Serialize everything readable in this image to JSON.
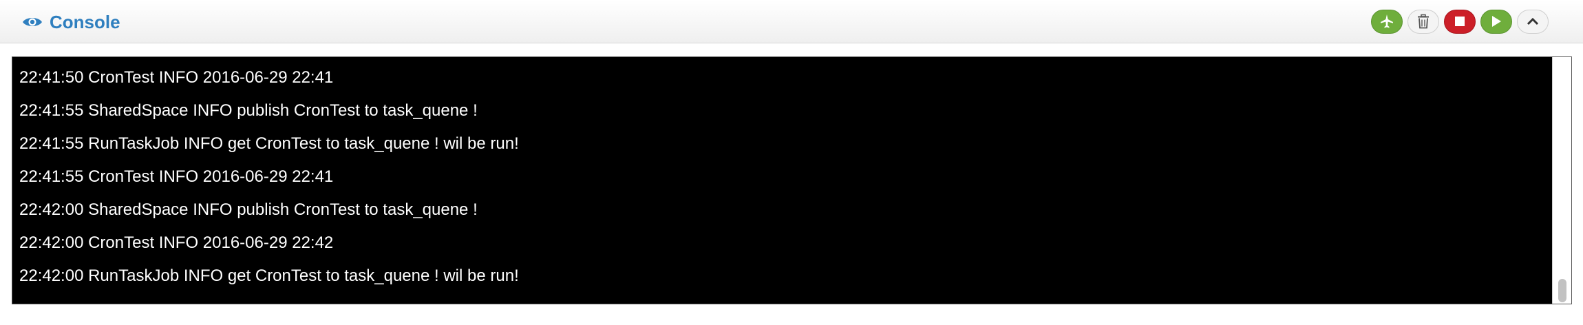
{
  "panel": {
    "title": "Console",
    "title_icon": "eye-icon",
    "accent_color": "#2f7fbf"
  },
  "toolbar": {
    "buttons": [
      {
        "name": "deploy-button",
        "icon": "plane-icon",
        "color": "#6fae3c"
      },
      {
        "name": "clear-button",
        "icon": "trash-icon",
        "color": "#f4f4f4"
      },
      {
        "name": "stop-button",
        "icon": "stop-icon",
        "color": "#cc1f28"
      },
      {
        "name": "run-button",
        "icon": "play-icon",
        "color": "#6fae3c"
      },
      {
        "name": "collapse-button",
        "icon": "chevron-up-icon",
        "color": "#f4f4f4"
      }
    ]
  },
  "console": {
    "background": "#000000",
    "text_color": "#ffffff",
    "lines": [
      "22:41:50 CronTest INFO 2016-06-29 22:41",
      "22:41:55 SharedSpace INFO publish CronTest to task_quene !",
      "22:41:55 RunTaskJob INFO get CronTest to task_quene ! wil be run!",
      "22:41:55 CronTest INFO 2016-06-29 22:41",
      "22:42:00 SharedSpace INFO publish CronTest to task_quene !",
      "22:42:00 CronTest INFO 2016-06-29 22:42",
      "22:42:00 RunTaskJob INFO get CronTest to task_quene ! wil be run!"
    ]
  }
}
